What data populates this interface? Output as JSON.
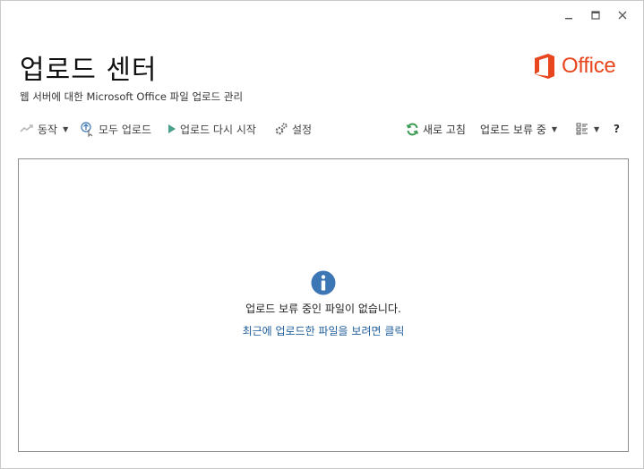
{
  "window": {
    "title": "업로드 센터",
    "subtitle": "웹 서버에 대한 Microsoft Office 파일 업로드 관리"
  },
  "logo": {
    "text": "Office"
  },
  "toolbar": {
    "actions_label": "동작",
    "upload_all_label": "모두 업로드",
    "resume_upload_label": "업로드 다시 시작",
    "settings_label": "설정",
    "refresh_label": "새로 고침",
    "filter_label": "업로드 보류 중",
    "help_label": "?"
  },
  "main": {
    "empty_message": "업로드 보류 중인 파일이 없습니다.",
    "recent_link": "최근에 업로드한 파일을 보려면 클릭"
  },
  "colors": {
    "accent_link": "#1f5d9a",
    "office_brand": "#e8461e",
    "info_icon": "#3d76b5",
    "play_icon": "#4aa08a",
    "refresh_icon": "#3a9a52"
  }
}
